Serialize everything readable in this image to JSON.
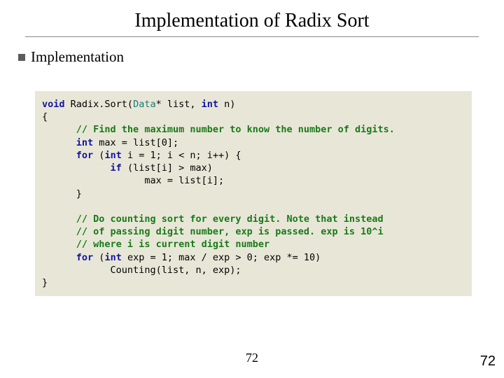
{
  "title": "Implementation of Radix Sort",
  "bullet": "Implementation",
  "code": {
    "l1a": "void",
    "l1b": " Radix.Sort(",
    "l1c": "Data",
    "l1d": "* list, ",
    "l1e": "int",
    "l1f": " n)",
    "l2": "{",
    "c1": "// Find the maximum number to know the number of digits.",
    "l3a": "int",
    "l3b": " max = list[0];",
    "l4a": "for",
    "l4b": " (",
    "l4c": "int",
    "l4d": " i = 1; i < n; i++) {",
    "l5a": "if",
    "l5b": " (list[i] > max)",
    "l6": "max = list[i];",
    "l7": "}",
    "c2": "// Do counting sort for every digit. Note that instead",
    "c3": "// of passing digit number, exp is passed. exp is 10^i",
    "c4": "// where i is current digit number",
    "l8a": "for",
    "l8b": " (",
    "l8c": "int",
    "l8d": " exp = 1; max / exp > 0; exp *= 10)",
    "l9": "Counting(list, n, exp);",
    "l10": "}"
  },
  "page_center": "72",
  "page_corner": "72"
}
